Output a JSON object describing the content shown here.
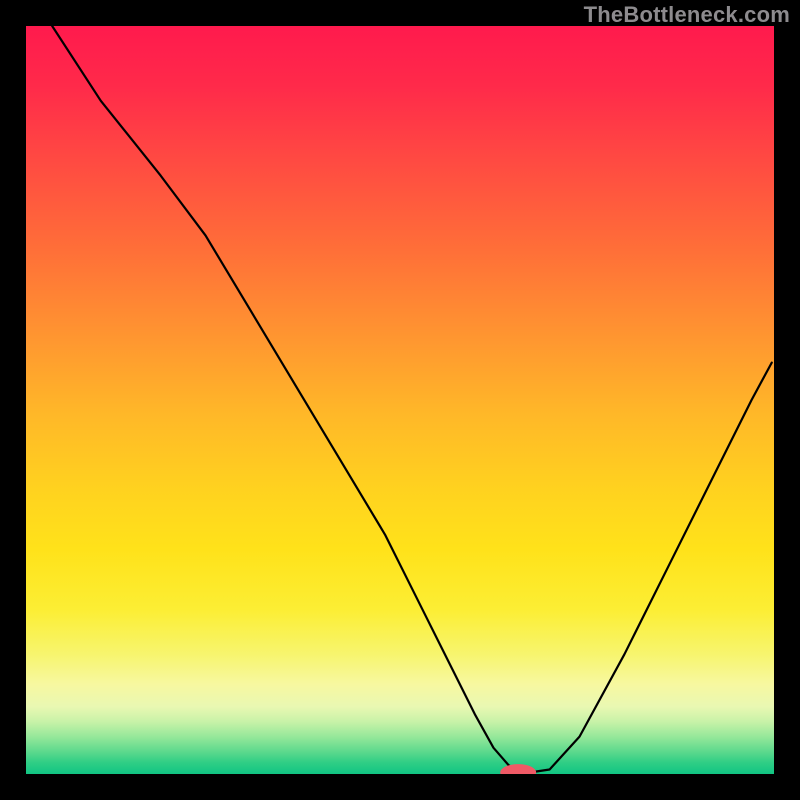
{
  "watermark": "TheBottleneck.com",
  "chart_data": {
    "type": "line",
    "title": "",
    "xlabel": "",
    "ylabel": "",
    "xlim": [
      0,
      100
    ],
    "ylim": [
      0,
      100
    ],
    "grid": false,
    "series": [
      {
        "name": "bottleneck-curve",
        "x": [
          3.5,
          10,
          18,
          24,
          30,
          36,
          42,
          48,
          53,
          57,
          60,
          62.5,
          64.5,
          66,
          67,
          70,
          74,
          80,
          86,
          92,
          97,
          99.7
        ],
        "values": [
          100,
          90,
          80,
          72,
          62,
          52,
          42,
          32,
          22,
          14,
          8,
          3.5,
          1.2,
          0.3,
          0.15,
          0.6,
          5,
          16,
          28,
          40,
          50,
          55
        ]
      }
    ],
    "marker": {
      "name": "optimal-point",
      "x": 65.8,
      "y": 0.22,
      "rx": 2.4,
      "ry": 1.1,
      "color": "#ef5a66"
    },
    "gradient_stops": [
      {
        "pos": 0,
        "color": "#ff1a4d"
      },
      {
        "pos": 0.5,
        "color": "#ffd21f"
      },
      {
        "pos": 0.88,
        "color": "#f7f8a0"
      },
      {
        "pos": 1.0,
        "color": "#11c583"
      }
    ]
  }
}
